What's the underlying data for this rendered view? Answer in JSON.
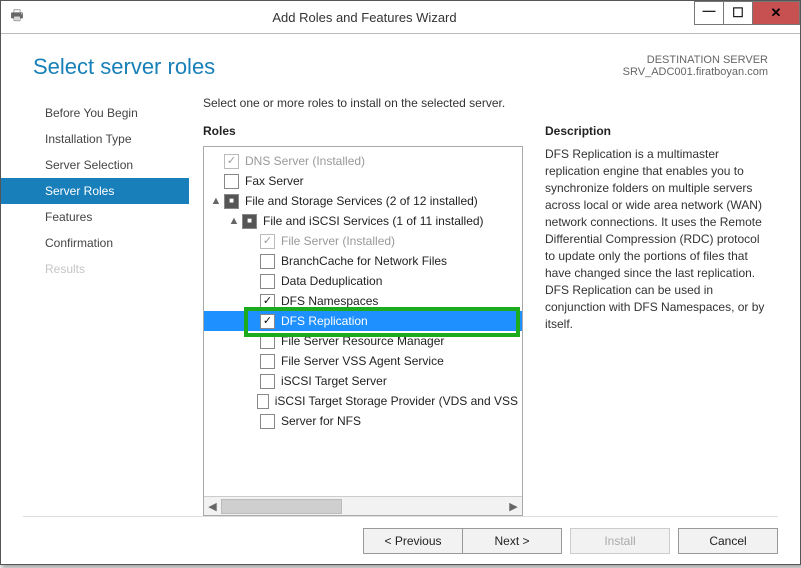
{
  "titlebar": {
    "title": "Add Roles and Features Wizard"
  },
  "header": {
    "heading": "Select server roles",
    "destination_label": "DESTINATION SERVER",
    "destination_host": "SRV_ADC001.firatboyan.com"
  },
  "nav": {
    "items": [
      {
        "label": "Before You Begin",
        "selected": false,
        "disabled": false
      },
      {
        "label": "Installation Type",
        "selected": false,
        "disabled": false
      },
      {
        "label": "Server Selection",
        "selected": false,
        "disabled": false
      },
      {
        "label": "Server Roles",
        "selected": true,
        "disabled": false
      },
      {
        "label": "Features",
        "selected": false,
        "disabled": false
      },
      {
        "label": "Confirmation",
        "selected": false,
        "disabled": false
      },
      {
        "label": "Results",
        "selected": false,
        "disabled": true
      }
    ]
  },
  "main": {
    "instruction": "Select one or more roles to install on the selected server.",
    "roles_label": "Roles",
    "description_label": "Description",
    "description_text": "DFS Replication is a multimaster replication engine that enables you to synchronize folders on multiple servers across local or wide area network (WAN) network connections. It uses the Remote Differential Compression (RDC) protocol to update only the portions of files that have changed since the last replication. DFS Replication can be used in conjunction with DFS Namespaces, or by itself."
  },
  "tree": {
    "nodes": [
      {
        "indent": 0,
        "expander": "",
        "check": "checked_disabled",
        "label": "DNS Server (Installed)",
        "disabled": true
      },
      {
        "indent": 0,
        "expander": "",
        "check": "unchecked",
        "label": "Fax Server"
      },
      {
        "indent": 0,
        "expander": "▲",
        "check": "partial",
        "label": "File and Storage Services (2 of 12 installed)"
      },
      {
        "indent": 1,
        "expander": "▲",
        "check": "partial",
        "label": "File and iSCSI Services (1 of 11 installed)"
      },
      {
        "indent": 2,
        "expander": "",
        "check": "checked_disabled",
        "label": "File Server (Installed)",
        "disabled": true
      },
      {
        "indent": 2,
        "expander": "",
        "check": "unchecked",
        "label": "BranchCache for Network Files"
      },
      {
        "indent": 2,
        "expander": "",
        "check": "unchecked",
        "label": "Data Deduplication"
      },
      {
        "indent": 2,
        "expander": "",
        "check": "checked",
        "label": "DFS Namespaces"
      },
      {
        "indent": 2,
        "expander": "",
        "check": "checked",
        "label": "DFS Replication",
        "selected": true
      },
      {
        "indent": 2,
        "expander": "",
        "check": "unchecked",
        "label": "File Server Resource Manager"
      },
      {
        "indent": 2,
        "expander": "",
        "check": "unchecked",
        "label": "File Server VSS Agent Service"
      },
      {
        "indent": 2,
        "expander": "",
        "check": "unchecked",
        "label": "iSCSI Target Server"
      },
      {
        "indent": 2,
        "expander": "",
        "check": "unchecked",
        "label": "iSCSI Target Storage Provider (VDS and VSS"
      },
      {
        "indent": 2,
        "expander": "",
        "check": "unchecked",
        "label": "Server for NFS"
      }
    ]
  },
  "footer": {
    "previous": "< Previous",
    "next": "Next >",
    "install": "Install",
    "cancel": "Cancel"
  }
}
